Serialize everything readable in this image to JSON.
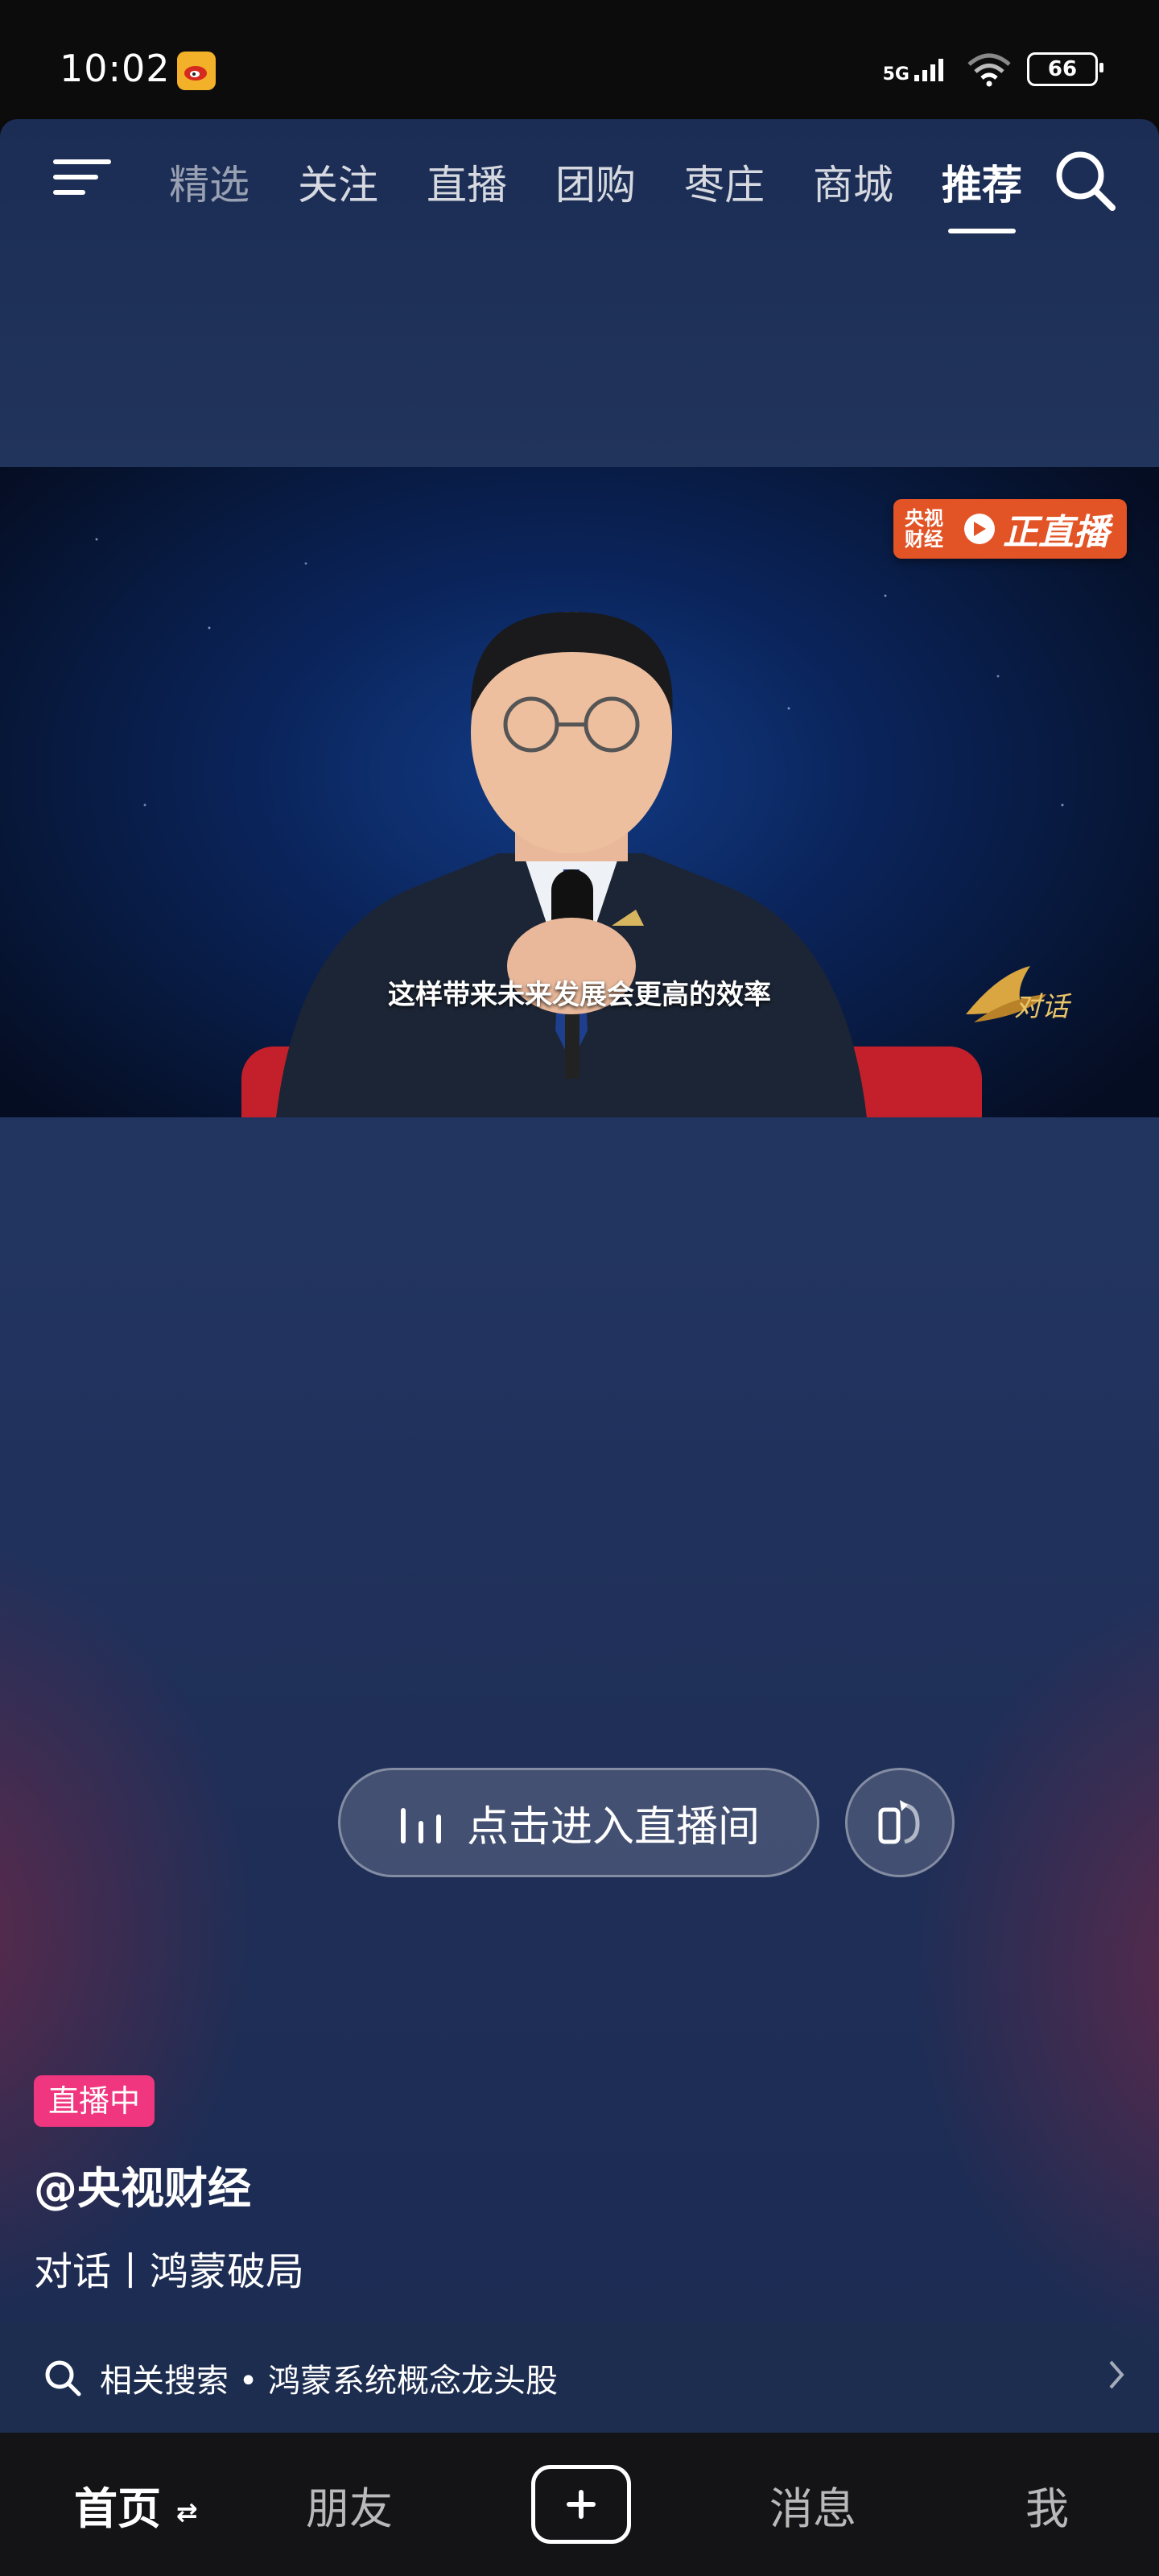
{
  "status_bar": {
    "time": "10:02",
    "network": "5G",
    "battery": "66"
  },
  "top_nav": {
    "tabs": [
      "精选",
      "关注",
      "直播",
      "团购",
      "枣庄",
      "商城",
      "推荐"
    ],
    "active_tab": "推荐"
  },
  "video": {
    "live_badge_brand": "央视财经",
    "live_badge_text": "正直播",
    "subtitle": "这样带来未来发展会更高的效率",
    "show_logo": "对话"
  },
  "actions": {
    "enter_live_label": "点击进入直播间"
  },
  "info": {
    "status_badge": "直播中",
    "author": "@央视财经",
    "title": "对话丨鸿蒙破局",
    "related_search": "相关搜索 • 鸿蒙系统概念龙头股"
  },
  "bottom_nav": {
    "home": "首页",
    "friends": "朋友",
    "messages": "消息",
    "me": "我"
  },
  "colors": {
    "live_badge": "#f0367f",
    "cctv_badge": "#e25326"
  }
}
